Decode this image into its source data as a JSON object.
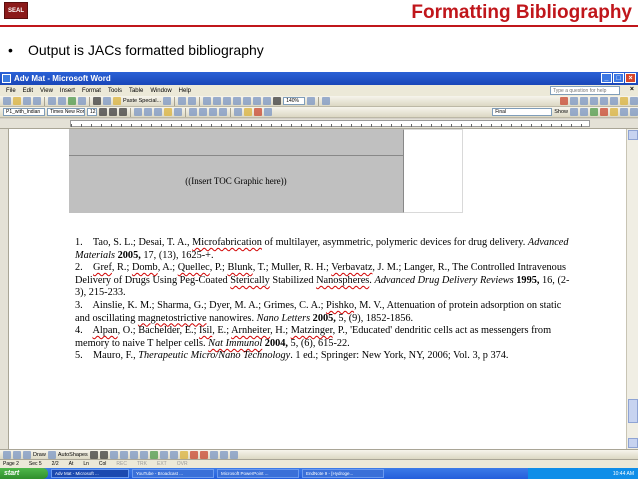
{
  "slide": {
    "logo_text": "SEAL",
    "title": "Formatting Bibliography",
    "bullet": "Output is JACs formatted bibliography"
  },
  "word": {
    "title": "Adv Mat - Microsoft Word",
    "menu": [
      "File",
      "Edit",
      "View",
      "Insert",
      "Format",
      "Tools",
      "Table",
      "Window",
      "Help"
    ],
    "help_placeholder": "Type a question for help",
    "zoom": "140%",
    "paste_special": "Paste Special...",
    "style": "P1_with_Indian",
    "font": "Times New Roman",
    "font_size": "12",
    "markup_view": "Final",
    "show_label": "Show",
    "draw_label": "Draw",
    "autoshapes_label": "AutoShapes",
    "toc_placeholder": "((Insert TOC Graphic here))",
    "status": [
      "Page 2",
      "Sec 5",
      "2/2",
      "At",
      "Ln",
      "Col",
      "REC",
      "TRK",
      "EXT",
      "OVR"
    ],
    "accent": "#c0161b"
  },
  "bibliography": [
    {
      "num": "1.",
      "parts": [
        {
          "t": "Tao, S. L.; Desai, T. A., "
        },
        {
          "t": "Microfabrication",
          "sq": true
        },
        {
          "t": " of multilayer, asymmetric, polymeric devices for drug delivery. "
        },
        {
          "t": "Advanced Materials",
          "i": true
        },
        {
          "t": " "
        },
        {
          "t": "2005,",
          "b": true
        },
        {
          "t": " 17, (13), 1625-+."
        }
      ]
    },
    {
      "num": "2.",
      "parts": [
        {
          "t": "Gref",
          "sq": true
        },
        {
          "t": ", R.; "
        },
        {
          "t": "Domb",
          "sq": true
        },
        {
          "t": ", A.; "
        },
        {
          "t": "Quellec",
          "sq": true
        },
        {
          "t": ", P.; "
        },
        {
          "t": "Blunk",
          "sq": true
        },
        {
          "t": ", T.; Muller, R. H.; "
        },
        {
          "t": "Verbavatz",
          "sq": true
        },
        {
          "t": ", J. M.; Langer, R., The Controlled Intravenous Delivery of Drugs Using Peg-Coated "
        },
        {
          "t": "Sterically",
          "sq": true
        },
        {
          "t": " Stabilized "
        },
        {
          "t": "Nanospheres",
          "sq": true
        },
        {
          "t": ". "
        },
        {
          "t": "Advanced Drug Delivery Reviews",
          "i": true
        },
        {
          "t": " "
        },
        {
          "t": "1995,",
          "b": true
        },
        {
          "t": " 16, (2-3), 215-233."
        }
      ]
    },
    {
      "num": "3.",
      "parts": [
        {
          "t": "Ainslie, K. M.; Sharma, G.; Dyer, M. A.; Grimes, C. A.; "
        },
        {
          "t": "Pishko",
          "sq": true
        },
        {
          "t": ", M. V., Attenuation of protein adsorption on static and oscillating "
        },
        {
          "t": "magnetostrictive",
          "sq": true
        },
        {
          "t": " nanowires. "
        },
        {
          "t": "Nano Letters",
          "i": true
        },
        {
          "t": " "
        },
        {
          "t": "2005,",
          "b": true
        },
        {
          "t": " 5, (9), 1852-1856."
        }
      ]
    },
    {
      "num": "4.",
      "parts": [
        {
          "t": "Alpan",
          "sq": true
        },
        {
          "t": ", O.; Bachelder, E.; "
        },
        {
          "t": "Isil",
          "sq": true
        },
        {
          "t": ", E.; "
        },
        {
          "t": "Arnheiter",
          "sq": true
        },
        {
          "t": ", H.; "
        },
        {
          "t": "Matzinger",
          "sq": true
        },
        {
          "t": ", P., 'Educated' dendritic cells act as messengers from memory to naive T helper cells. "
        },
        {
          "t": "Nat Immunol",
          "i": true,
          "sq": true
        },
        {
          "t": " "
        },
        {
          "t": "2004,",
          "b": true
        },
        {
          "t": " 5, (6), 615-22."
        }
      ]
    },
    {
      "num": "5.",
      "parts": [
        {
          "t": "Mauro, F., "
        },
        {
          "t": "Therapeutic Micro/Nano Technology",
          "i": true
        },
        {
          "t": ". 1 ed.; Springer: New York, NY, 2006; Vol. 3, p 374."
        }
      ]
    }
  ],
  "taskbar": {
    "start": "start",
    "tasks": [
      "Adv Mat - Microsoft ...",
      "YouTube - Broadcast ...",
      "Microsoft PowerPoint ...",
      "EndNote 9 - [Hydroge..."
    ],
    "clock": "10:44 AM"
  }
}
